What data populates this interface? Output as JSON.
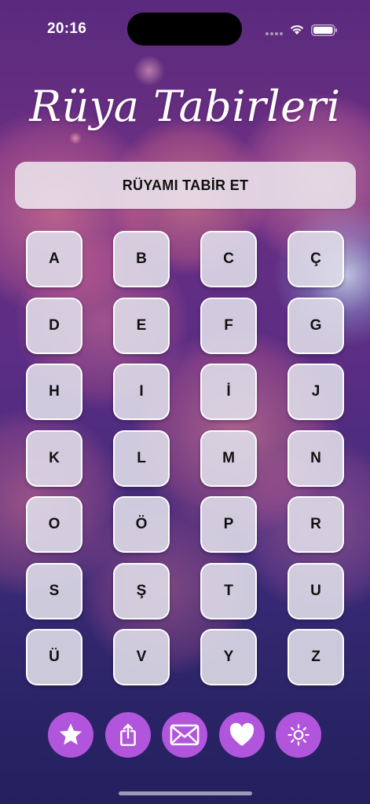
{
  "status_bar": {
    "time": "20:16",
    "wifi_icon": "wifi-icon",
    "battery_icon": "battery-icon"
  },
  "header": {
    "title": "Rüya Tabirleri"
  },
  "main": {
    "interpret_button_label": "RÜYAMI TABİR ET",
    "letters": [
      "A",
      "B",
      "C",
      "Ç",
      "D",
      "E",
      "F",
      "G",
      "H",
      "I",
      "İ",
      "J",
      "K",
      "L",
      "M",
      "N",
      "O",
      "Ö",
      "P",
      "R",
      "S",
      "Ş",
      "T",
      "U",
      "Ü",
      "V",
      "Y",
      "Z"
    ]
  },
  "toolbar": {
    "buttons": [
      {
        "icon": "star-icon",
        "name": "favorites-button"
      },
      {
        "icon": "share-icon",
        "name": "share-button"
      },
      {
        "icon": "mail-icon",
        "name": "mail-button"
      },
      {
        "icon": "heart-icon",
        "name": "like-button"
      },
      {
        "icon": "sun-icon",
        "name": "brightness-button"
      }
    ],
    "accent_color": "#b155dc"
  },
  "colors": {
    "background_top": "#5a2a7e",
    "background_bottom": "#241f5e",
    "key_background": "#dedce8"
  }
}
